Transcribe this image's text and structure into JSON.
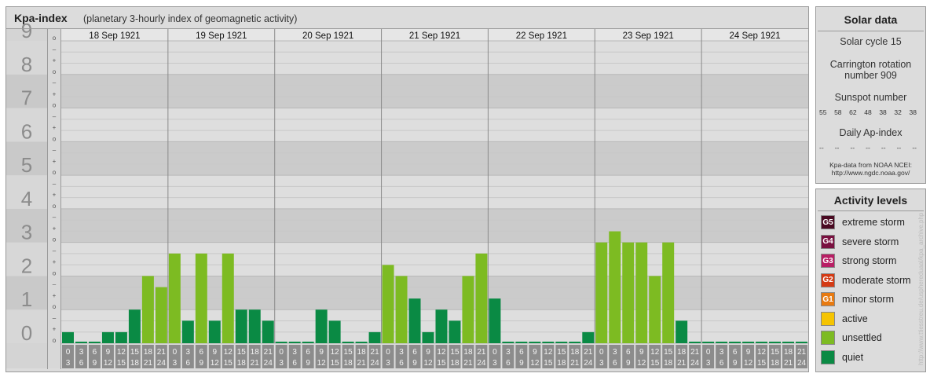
{
  "header": {
    "title": "Kpa-index",
    "subtitle": "(planetary 3-hourly index of geomagnetic activity)"
  },
  "chart_data": {
    "type": "bar",
    "title": "Kpa-index",
    "subtitle": "(planetary 3-hourly index of geomagnetic activity)",
    "ylim": [
      0,
      9
    ],
    "y_major_ticks": [
      "0",
      "1",
      "2",
      "3",
      "4",
      "5",
      "6",
      "7",
      "8",
      "9"
    ],
    "y_minor_ticks": [
      "+",
      "–",
      "o"
    ],
    "days": [
      "18 Sep 1921",
      "19 Sep 1921",
      "20 Sep 1921",
      "21 Sep 1921",
      "22 Sep 1921",
      "23 Sep 1921",
      "24 Sep 1921"
    ],
    "interval_start_hours": [
      "0",
      "3",
      "6",
      "9",
      "12",
      "15",
      "18",
      "21"
    ],
    "interval_end_hours": [
      "3",
      "6",
      "9",
      "12",
      "15",
      "18",
      "21",
      "24"
    ],
    "values": [
      [
        0.33,
        0,
        0,
        0.33,
        0.33,
        1,
        2,
        1.67
      ],
      [
        2.67,
        0.67,
        2.67,
        0.67,
        2.67,
        1,
        1,
        0.67
      ],
      [
        0,
        0,
        0,
        1,
        0.67,
        0,
        0,
        0.33
      ],
      [
        2.33,
        2,
        1.33,
        0.33,
        1,
        0.67,
        2,
        2.67
      ],
      [
        1.33,
        0,
        0,
        0,
        0,
        0,
        0,
        0.33
      ],
      [
        3,
        3.33,
        3,
        3,
        2,
        3,
        0.67,
        0
      ],
      [
        0,
        0,
        0,
        0,
        0,
        0,
        0,
        0
      ]
    ],
    "colors": {
      "quiet": "#0a8a44",
      "unsettled": "#7dbb22",
      "active": "#f5c400",
      "g1": "#e87a10",
      "g2": "#d43a14",
      "g3": "#b81e64",
      "g4": "#7a1040",
      "g5": "#4a0a22"
    },
    "grid": true
  },
  "solar": {
    "title": "Solar data",
    "cycle": "Solar cycle 15",
    "carrington_line1": "Carrington rotation",
    "carrington_line2": "number 909",
    "sunspot_label": "Sunspot number",
    "sunspot_values": [
      "55",
      "58",
      "62",
      "48",
      "38",
      "32",
      "38"
    ],
    "ap_label": "Daily Ap-index",
    "ap_values": [
      "--",
      "--",
      "--",
      "--",
      "--",
      "--",
      "--"
    ],
    "source_line1": "Kpa-data from NOAA NCEI:",
    "source_line2": "http://www.ngdc.noaa.gov/"
  },
  "activity": {
    "title": "Activity levels",
    "levels": [
      {
        "code": "G5",
        "label": "extreme storm",
        "color": "#4a0a22"
      },
      {
        "code": "G4",
        "label": "severe storm",
        "color": "#7a1040"
      },
      {
        "code": "G3",
        "label": "strong storm",
        "color": "#b81e64"
      },
      {
        "code": "G2",
        "label": "moderate storm",
        "color": "#d43a14"
      },
      {
        "code": "G1",
        "label": "minor storm",
        "color": "#e87a10"
      },
      {
        "code": "",
        "label": "active",
        "color": "#f5c400"
      },
      {
        "code": "",
        "label": "unsettled",
        "color": "#7dbb22"
      },
      {
        "code": "",
        "label": "quiet",
        "color": "#0a8a44"
      }
    ]
  },
  "credit": "http://www.ttiesstreu.de/usphereduaal/kpa_archive.php"
}
